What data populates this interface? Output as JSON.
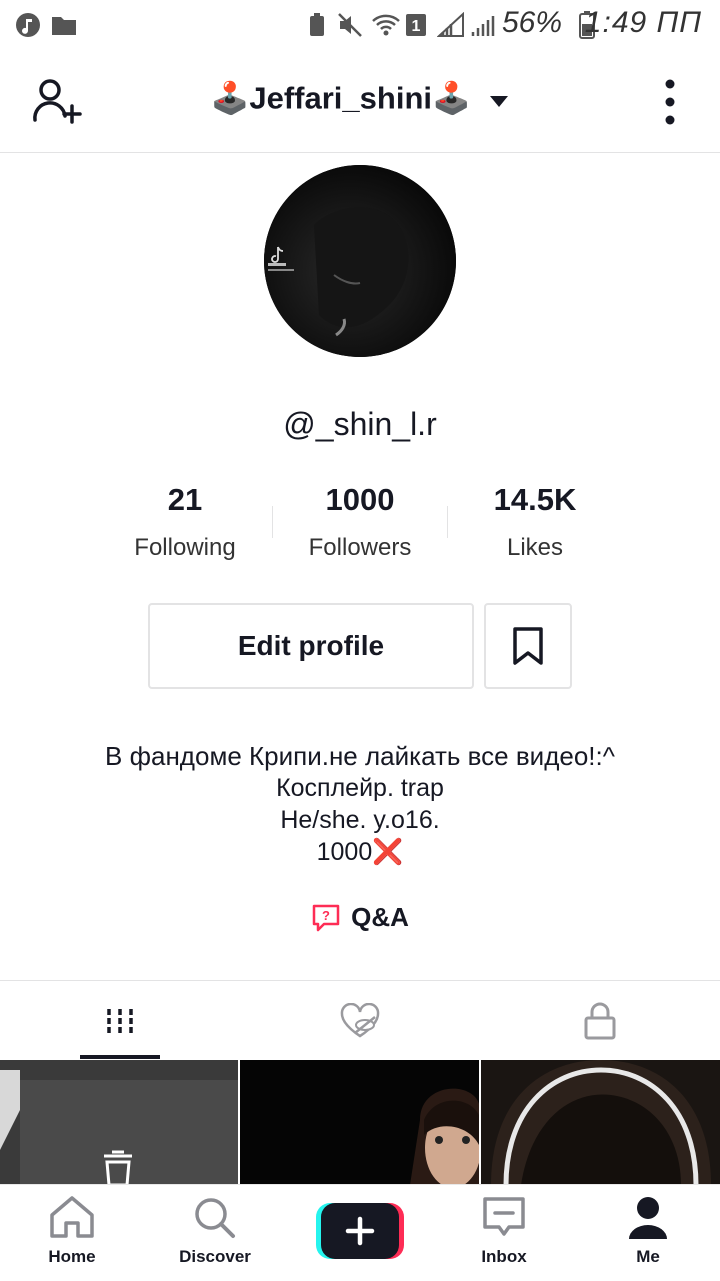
{
  "status_bar": {
    "battery": "56%",
    "time": "1:49 ПП"
  },
  "header": {
    "title": "🕹️Jeffari_shini🕹️"
  },
  "profile": {
    "handle": "@_shin_l.r",
    "stats": [
      {
        "value": "21",
        "label": "Following"
      },
      {
        "value": "1000",
        "label": "Followers"
      },
      {
        "value": "14.5K",
        "label": "Likes"
      }
    ],
    "edit_label": "Edit profile",
    "bio": [
      "В фандоме Крипи.не лайкать все видео!:^",
      "Косплейр. trap",
      "He/she. y.o16.",
      "1000❌"
    ],
    "qa_label": "Q&A"
  },
  "bottom_nav": {
    "home": "Home",
    "discover": "Discover",
    "inbox": "Inbox",
    "me": "Me"
  },
  "colors": {
    "accent": "#fe2c55",
    "cyan": "#25f4ee",
    "text": "#161823"
  }
}
